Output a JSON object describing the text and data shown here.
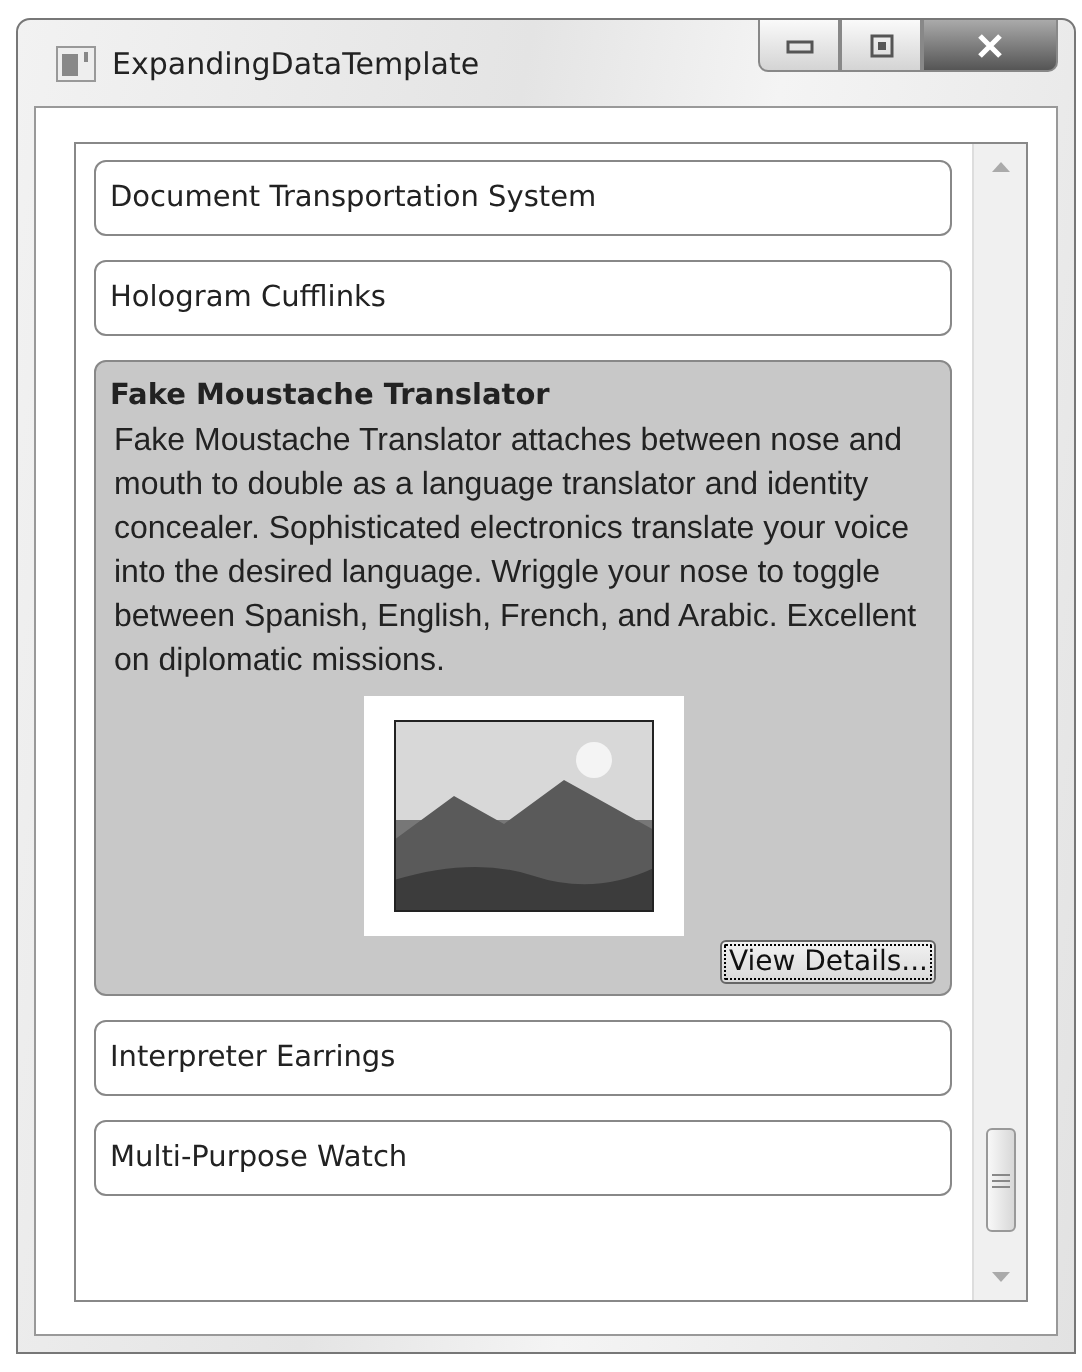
{
  "window": {
    "title": "ExpandingDataTemplate"
  },
  "items": [
    {
      "name": "Document Transportation System",
      "selected": false
    },
    {
      "name": "Hologram Cufflinks",
      "selected": false
    },
    {
      "name": "Fake Moustache Translator",
      "selected": true,
      "description": "Fake Moustache Translator attaches between nose and mouth to double as a language translator and identity concealer. Sophisticated electronics translate your voice into the desired language. Wriggle your nose to toggle between Spanish, English, French, and Arabic. Excellent on diplomatic missions.",
      "button": "View Details..."
    },
    {
      "name": "Interpreter Earrings",
      "selected": false
    },
    {
      "name": "Multi-Purpose Watch",
      "selected": false
    }
  ]
}
